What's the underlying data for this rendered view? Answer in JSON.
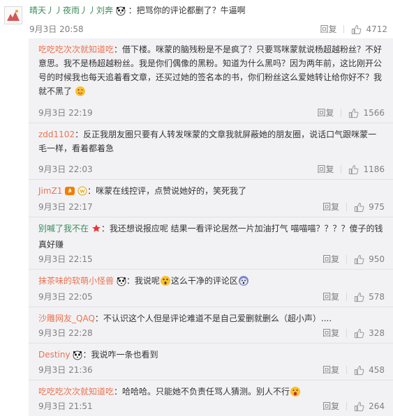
{
  "top_comment": {
    "user": "晴天丿丿夜雨丿丿刘奔",
    "text": "：把骂你的评论都删了？牛逼啊",
    "time": "9月3日 20:58",
    "reply_label": "回复",
    "likes": "4712"
  },
  "replies": [
    {
      "user": "吃吃吃次次就知道吃",
      "text": "：借下楼。咪蒙的脑残粉是不是疯了？只要骂咪蒙就说杨超越粉丝？不好意思。我不是杨超越粉丝。我是你们偶像的黑粉。知道为什么黑吗？因为两年前，这比刚开公号的时候我也每天追着看文章，还买过她的签名本的书，你们粉丝这么爱她转让给你好不？我就不黑了",
      "time": "9月3日 22:19",
      "reply_label": "回复",
      "likes": "1566"
    },
    {
      "user": "zdd1102",
      "text": "：反正我朋友圈只要有人转发咪蒙的文章我就屏蔽她的朋友圈，说话口气跟咪蒙一毛一样，看着都着急",
      "time": "9月3日 22:03",
      "reply_label": "回复",
      "likes": "1186"
    },
    {
      "user": "JimZ1",
      "text": "：咪蒙在线控评，点赞说她好的，笑死我了",
      "time": "9月3日 22:17",
      "reply_label": "回复",
      "likes": "975"
    },
    {
      "user": "别喊了我不在",
      "text": "：我还想说报应呢 结果一看评论居然一片加油打气 喵喵喵？？？？傻子的钱真好赚",
      "time": "9月3日 22:15",
      "reply_label": "回复",
      "likes": "950"
    },
    {
      "user": "抹茶味的软萌小怪兽",
      "text_a": "：我说呢",
      "text_b": "这么干净的评论区",
      "time": "9月3日 22:05",
      "reply_label": "回复",
      "likes": "578"
    },
    {
      "user": "沙雕网友_QAQ",
      "text": "：不认识这个人但是评论难道不是自己爱删就删么（超小声）....",
      "time": "9月3日 22:28",
      "reply_label": "回复",
      "likes": "328"
    },
    {
      "user": "Destiny",
      "text": "：我说咋一条也看到",
      "time": "9月3日 21:36",
      "reply_label": "回复",
      "likes": "458"
    },
    {
      "user": "吃吃吃次次就知道吃",
      "text": "：哈哈哈。只能她不负责任骂人猜测。别人不行",
      "time": "9月3日 21:51",
      "reply_label": "回复",
      "likes": "264"
    }
  ],
  "colors": {
    "username": "#eb7350",
    "meta": "#808080",
    "reply_bg": "#f2f2f5",
    "divider": "#e1e1e6"
  },
  "icons": [
    "avatar",
    "panda-icon",
    "thumbs-up-icon",
    "smile-emoji",
    "tongue-emoji",
    "fire-badge",
    "vip-badge",
    "star-badge",
    "shock-emoji",
    "scream-emoji",
    "fish-emoji"
  ]
}
